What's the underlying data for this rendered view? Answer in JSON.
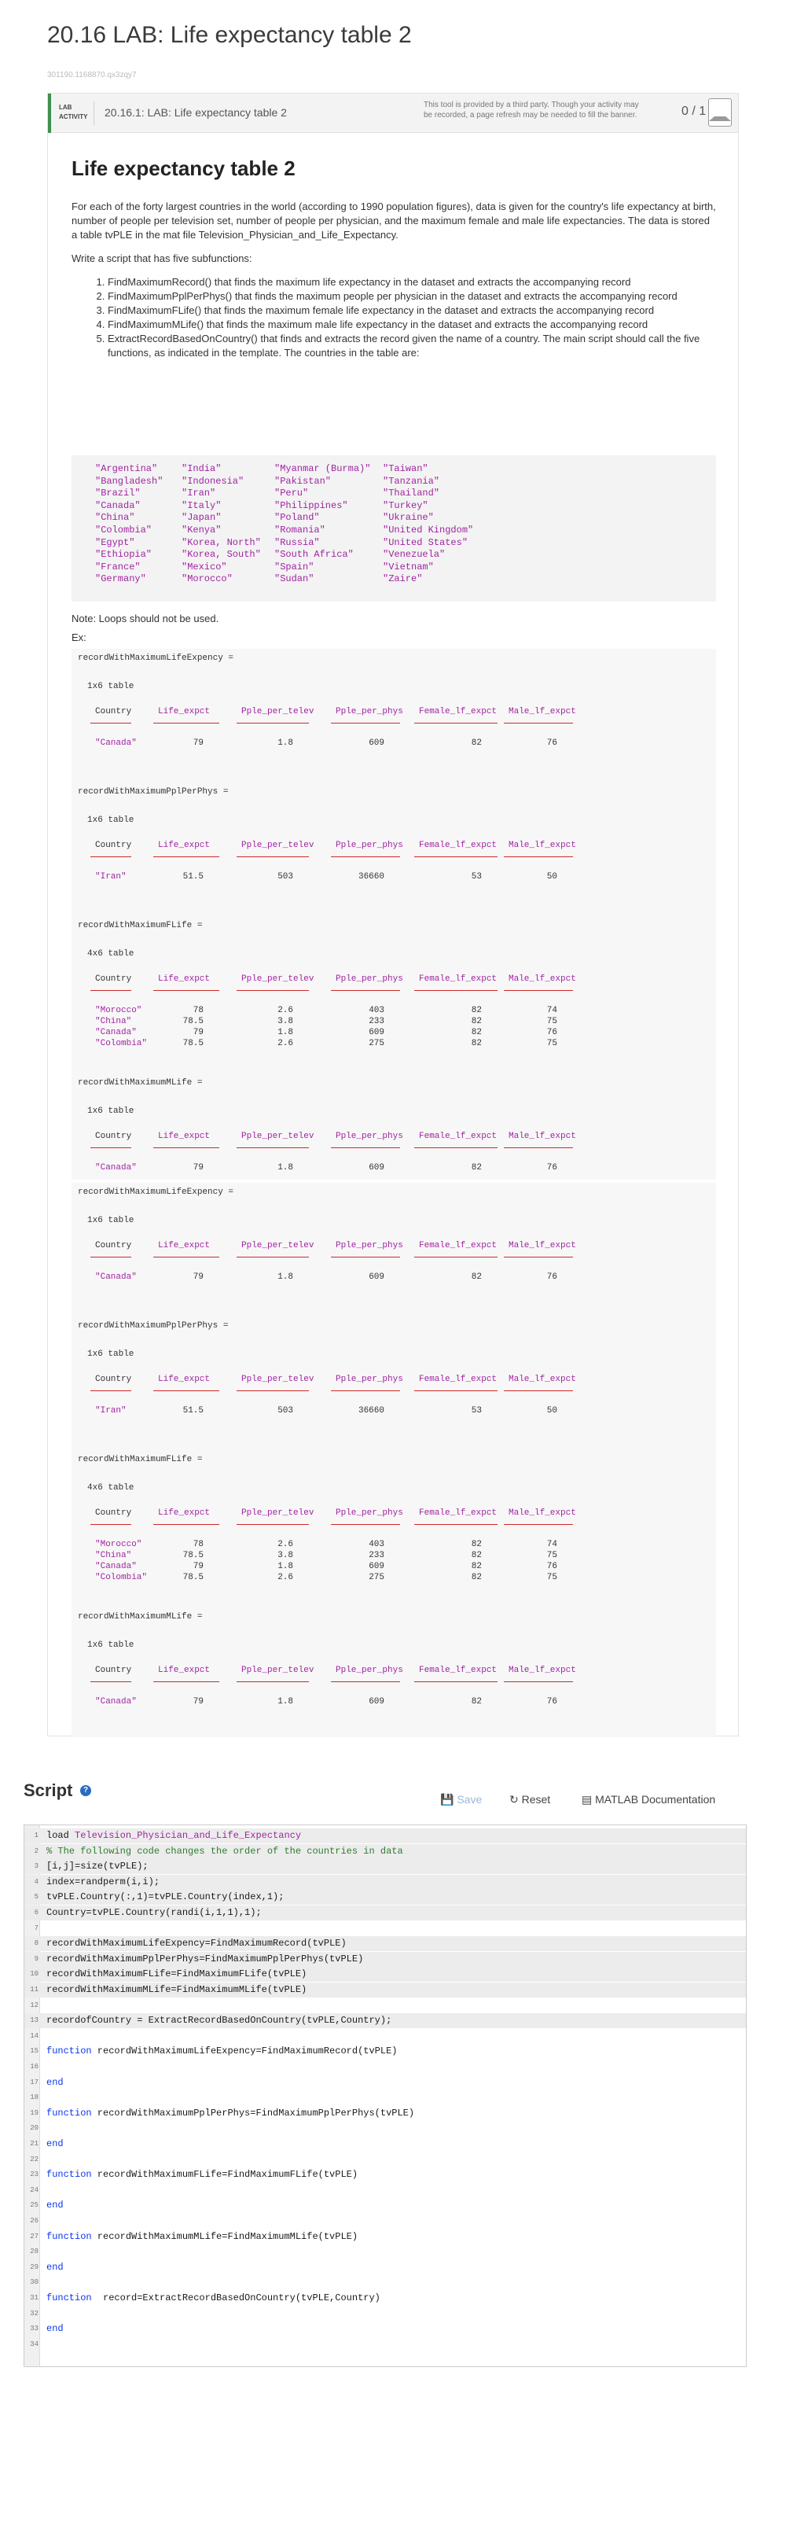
{
  "page": {
    "title": "20.16 LAB: Life expectancy table 2",
    "subtitle": "301190.1168870.qx3zqy7"
  },
  "lab": {
    "badge": "LAB ACTIVITY",
    "name": "20.16.1: LAB: Life expectancy table 2",
    "third_party_note": "This tool is provided by a third party. Though your activity may be recorded, a page refresh may be needed to fill the banner.",
    "score": "0 / 1"
  },
  "content": {
    "heading": "Life expectancy table 2",
    "intro": "For each of the forty largest countries in the world (according to 1990 population figures), data is given for the country's life expectancy at birth, number of people per television set, number of people per physician, and the maximum female and male life expectancies. The data is stored a table tvPLE in the mat file Television_Physician_and_Life_Expectancy.",
    "instruction": "Write a script that has five subfunctions:",
    "tasks": [
      "FindMaximumRecord() that finds the maximum life expectancy in the dataset and extracts the accompanying record",
      "FindMaximumPplPerPhys() that finds the maximum people per physician in the dataset and extracts the accompanying record",
      "FindMaximumFLife() that finds the maximum female life expectancy in the dataset and extracts the accompanying record",
      "FindMaximumMLife() that finds the maximum male life expectancy in the dataset and extracts the accompanying record",
      "ExtractRecordBasedOnCountry() that finds and extracts the record given the name of a country.  The main script should call the five functions, as indicated in the template. The countries in the table are:"
    ],
    "country_columns": [
      [
        "\"Argentina\"",
        "\"Bangladesh\"",
        "\"Brazil\"",
        "\"Canada\"",
        "\"China\"",
        "\"Colombia\"",
        "\"Egypt\"",
        "\"Ethiopia\"",
        "\"France\"",
        "\"Germany\""
      ],
      [
        "\"India\"",
        "\"Indonesia\"",
        "\"Iran\"",
        "\"Italy\"",
        "\"Japan\"",
        "\"Kenya\"",
        "\"Korea, North\"",
        "\"Korea, South\"",
        "\"Mexico\"",
        "\"Morocco\""
      ],
      [
        "\"Myanmar (Burma)\"",
        "\"Pakistan\"",
        "\"Peru\"",
        "\"Philippines\"",
        "\"Poland\"",
        "\"Romania\"",
        "\"Russia\"",
        "\"South Africa\"",
        "\"Spain\"",
        "\"Sudan\""
      ],
      [
        "\"Taiwan\"",
        "\"Tanzania\"",
        "\"Thailand\"",
        "\"Turkey\"",
        "\"Ukraine\"",
        "\"United Kingdom\"",
        "\"United States\"",
        "\"Venezuela\"",
        "\"Vietnam\"",
        "\"Zaire\""
      ]
    ],
    "note": "Note: Loops should not be used.",
    "ex": "Ex:"
  },
  "output_blocks": [
    {
      "columns": [
        "Country",
        "Life_expct",
        "Pple_per_telev",
        "Pple_per_phys",
        "Female_lf_expct",
        "Male_lf_expct"
      ],
      "tables": [
        {
          "var": "recordWithMaximumLifeExpency =",
          "size": "1x6 table",
          "rows": [
            [
              "\"Canada\"",
              "79",
              "1.8",
              "609",
              "82",
              "76"
            ]
          ]
        },
        {
          "var": "recordWithMaximumPplPerPhys =",
          "size": "1x6 table",
          "rows": [
            [
              "\"Iran\"",
              "51.5",
              "503",
              "36660",
              "53",
              "50"
            ]
          ]
        },
        {
          "var": "recordWithMaximumFLife =",
          "size": "4x6 table",
          "rows": [
            [
              "\"Morocco\"",
              "78",
              "2.6",
              "403",
              "82",
              "74"
            ],
            [
              "\"China\"",
              "78.5",
              "3.8",
              "233",
              "82",
              "75"
            ],
            [
              "\"Canada\"",
              "79",
              "1.8",
              "609",
              "82",
              "76"
            ],
            [
              "\"Colombia\"",
              "78.5",
              "2.6",
              "275",
              "82",
              "75"
            ]
          ]
        },
        {
          "var": "recordWithMaximumMLife =",
          "size": "1x6 table",
          "rows": [
            [
              "\"Canada\"",
              "79",
              "1.8",
              "609",
              "82",
              "76"
            ]
          ]
        }
      ]
    },
    {
      "columns": [
        "Country",
        "Life_expct",
        "Pple_per_telev",
        "Pple_per_phys",
        "Female_lf_expct",
        "Male_lf_expct"
      ],
      "tables": [
        {
          "var": "recordWithMaximumLifeExpency =",
          "size": "1x6 table",
          "rows": [
            [
              "\"Canada\"",
              "79",
              "1.8",
              "609",
              "82",
              "76"
            ]
          ]
        },
        {
          "var": "recordWithMaximumPplPerPhys =",
          "size": "1x6 table",
          "rows": [
            [
              "\"Iran\"",
              "51.5",
              "503",
              "36660",
              "53",
              "50"
            ]
          ]
        },
        {
          "var": "recordWithMaximumFLife =",
          "size": "4x6 table",
          "rows": [
            [
              "\"Morocco\"",
              "78",
              "2.6",
              "403",
              "82",
              "74"
            ],
            [
              "\"China\"",
              "78.5",
              "3.8",
              "233",
              "82",
              "75"
            ],
            [
              "\"Canada\"",
              "79",
              "1.8",
              "609",
              "82",
              "76"
            ],
            [
              "\"Colombia\"",
              "78.5",
              "2.6",
              "275",
              "82",
              "75"
            ]
          ]
        },
        {
          "var": "recordWithMaximumMLife =",
          "size": "1x6 table",
          "rows": [
            [
              "\"Canada\"",
              "79",
              "1.8",
              "609",
              "82",
              "76"
            ]
          ]
        }
      ]
    }
  ],
  "script": {
    "title": "Script",
    "save_label": "Save",
    "reset_label": "Reset",
    "docs_label": "MATLAB Documentation",
    "lines": [
      [
        {
          "t": "load ",
          "c": ""
        },
        {
          "t": "Television_Physician_and_Life_Expectancy",
          "c": "st"
        }
      ],
      [
        {
          "t": "% The following code changes the order of the countries in data",
          "c": "cm"
        }
      ],
      [
        {
          "t": "[i,j]=size(tvPLE);",
          "c": ""
        }
      ],
      [
        {
          "t": "index=randperm(i,i);",
          "c": ""
        }
      ],
      [
        {
          "t": "tvPLE.Country(:,1)=tvPLE.Country(index,1);",
          "c": ""
        }
      ],
      [
        {
          "t": "Country=tvPLE.Country(randi(i,1,1),1);",
          "c": ""
        }
      ],
      [],
      [
        {
          "t": "recordWithMaximumLifeExpency=FindMaximumRecord(tvPLE)",
          "c": ""
        }
      ],
      [
        {
          "t": "recordWithMaximumPplPerPhys=FindMaximumPplPerPhys(tvPLE)",
          "c": ""
        }
      ],
      [
        {
          "t": "recordWithMaximumFLife=FindMaximumFLife(tvPLE)",
          "c": ""
        }
      ],
      [
        {
          "t": "recordWithMaximumMLife=FindMaximumMLife(tvPLE)",
          "c": ""
        }
      ],
      [],
      [
        {
          "t": "recordofCountry = ExtractRecordBasedOnCountry(tvPLE,Country);",
          "c": ""
        }
      ],
      [],
      [
        {
          "t": "function",
          "c": "kw"
        },
        {
          "t": " recordWithMaximumLifeExpency=FindMaximumRecord(tvPLE)",
          "c": ""
        }
      ],
      [],
      [
        {
          "t": "end",
          "c": "kw"
        }
      ],
      [],
      [
        {
          "t": "function",
          "c": "kw"
        },
        {
          "t": " recordWithMaximumPplPerPhys=FindMaximumPplPerPhys(tvPLE)",
          "c": ""
        }
      ],
      [],
      [
        {
          "t": "end",
          "c": "kw"
        }
      ],
      [],
      [
        {
          "t": "function",
          "c": "kw"
        },
        {
          "t": " recordWithMaximumFLife=FindMaximumFLife(tvPLE)",
          "c": ""
        }
      ],
      [],
      [
        {
          "t": "end",
          "c": "kw"
        }
      ],
      [],
      [
        {
          "t": "function",
          "c": "kw"
        },
        {
          "t": " recordWithMaximumMLife=FindMaximumMLife(tvPLE)",
          "c": ""
        }
      ],
      [],
      [
        {
          "t": "end",
          "c": "kw"
        }
      ],
      [],
      [
        {
          "t": "function",
          "c": "kw"
        },
        {
          "t": "  record=ExtractRecordBasedOnCountry(tvPLE,Country)",
          "c": ""
        }
      ],
      [],
      [
        {
          "t": "end",
          "c": "kw"
        }
      ],
      []
    ],
    "highlighted_lines": [
      1,
      2,
      3,
      4,
      5,
      6,
      8,
      9,
      10,
      11,
      13
    ]
  }
}
